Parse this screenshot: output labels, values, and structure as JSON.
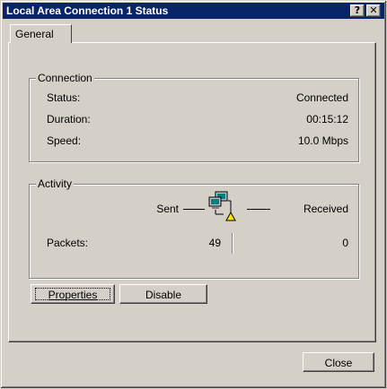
{
  "window": {
    "title": "Local Area Connection 1 Status",
    "help_glyph": "?",
    "close_glyph": "✕"
  },
  "tabs": [
    {
      "label": "General"
    }
  ],
  "connection": {
    "title": "Connection",
    "rows": [
      {
        "label": "Status:",
        "value": "Connected"
      },
      {
        "label": "Duration:",
        "value": "00:15:12"
      },
      {
        "label": "Speed:",
        "value": "10.0 Mbps"
      }
    ]
  },
  "activity": {
    "title": "Activity",
    "sent_label": "Sent",
    "received_label": "Received",
    "packets_label": "Packets:",
    "packets_sent": "49",
    "packets_received": "0",
    "icon": "network-computers-icon"
  },
  "buttons": {
    "properties": "Properties",
    "disable": "Disable",
    "close": "Close"
  },
  "colors": {
    "titlebar": "#0a246a",
    "face": "#d4d0c8"
  }
}
